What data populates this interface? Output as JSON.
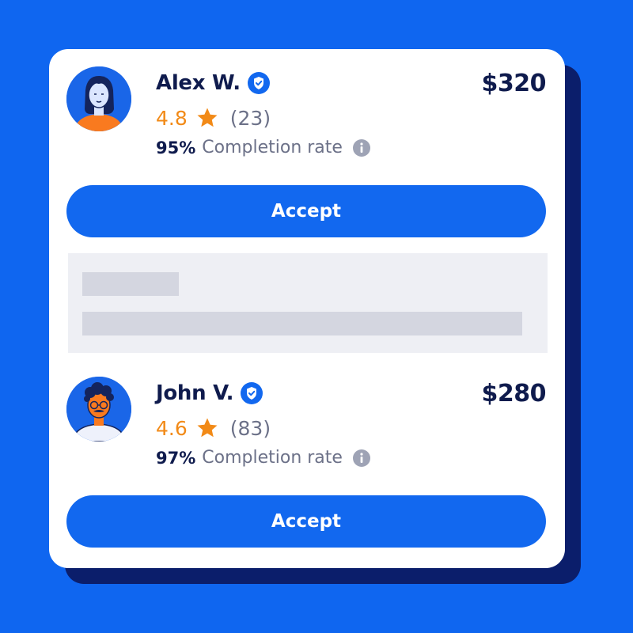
{
  "offers": [
    {
      "name": "Alex W.",
      "price": "$320",
      "rating": "4.8",
      "review_count": "(23)",
      "completion_pct": "95%",
      "completion_label": "Completion rate",
      "accept_label": "Accept",
      "icons": [
        "verified-badge-icon",
        "star-icon",
        "info-icon"
      ]
    },
    {
      "name": "John V.",
      "price": "$280",
      "rating": "4.6",
      "review_count": "(83)",
      "completion_pct": "97%",
      "completion_label": "Completion rate",
      "accept_label": "Accept",
      "icons": [
        "verified-badge-icon",
        "star-icon",
        "info-icon"
      ]
    }
  ],
  "colors": {
    "background": "#0f66f0",
    "accent": "#1268ef",
    "text_dark": "#0f1b4d",
    "rating": "#f28a17",
    "muted": "#6c7188",
    "card_shadow": "#0b1e6b"
  }
}
